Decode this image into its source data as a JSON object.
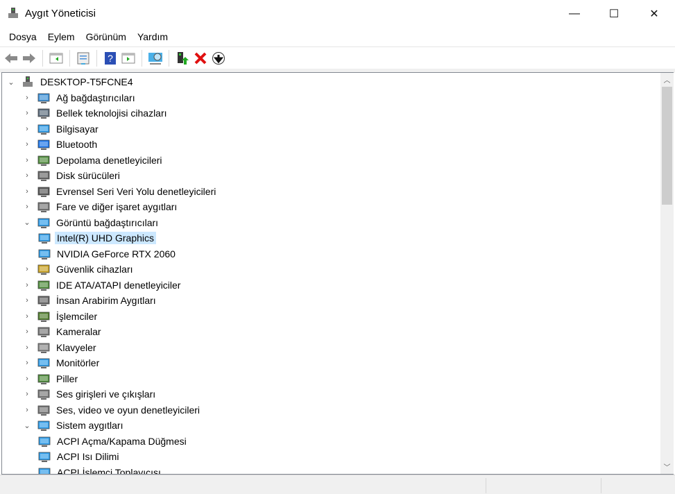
{
  "window": {
    "title": "Aygıt Yöneticisi",
    "minimize": "—",
    "maximize": "☐",
    "close": "✕"
  },
  "menu": [
    "Dosya",
    "Eylem",
    "Görünüm",
    "Yardım"
  ],
  "toolbar": [
    "back-icon",
    "forward-icon",
    "show-hide-console-tree-icon",
    "properties-icon",
    "help-icon",
    "show-action-pane-icon",
    "scan-hardware-icon",
    "update-driver-icon",
    "uninstall-icon",
    "disable-icon"
  ],
  "tree": {
    "root": "DESKTOP-T5FCNE4",
    "items": [
      {
        "label": "Ağ bağdaştırıcıları",
        "level": 1,
        "exp": "collapsed",
        "icon": "network-adapter-icon",
        "color": "#3a8fd6"
      },
      {
        "label": "Bellek teknolojisi cihazları",
        "level": 1,
        "exp": "collapsed",
        "icon": "memory-device-icon",
        "color": "#5a6a7a"
      },
      {
        "label": "Bilgisayar",
        "level": 1,
        "exp": "collapsed",
        "icon": "computer-icon",
        "color": "#2d9be8"
      },
      {
        "label": "Bluetooth",
        "level": 1,
        "exp": "collapsed",
        "icon": "bluetooth-icon",
        "color": "#1a73e8"
      },
      {
        "label": "Depolama denetleyicileri",
        "level": 1,
        "exp": "collapsed",
        "icon": "storage-controller-icon",
        "color": "#4d8a3a"
      },
      {
        "label": "Disk sürücüleri",
        "level": 1,
        "exp": "collapsed",
        "icon": "disk-drive-icon",
        "color": "#666"
      },
      {
        "label": "Evrensel Seri Veri Yolu denetleyicileri",
        "level": 1,
        "exp": "collapsed",
        "icon": "usb-icon",
        "color": "#555"
      },
      {
        "label": "Fare ve diğer işaret aygıtları",
        "level": 1,
        "exp": "collapsed",
        "icon": "mouse-icon",
        "color": "#777"
      },
      {
        "label": "Görüntü bağdaştırıcıları",
        "level": 1,
        "exp": "expanded",
        "icon": "display-adapter-icon",
        "color": "#2d9be8"
      },
      {
        "label": "Intel(R) UHD Graphics",
        "level": 2,
        "exp": "none",
        "icon": "display-adapter-icon",
        "color": "#2d9be8",
        "selected": true
      },
      {
        "label": "NVIDIA GeForce RTX 2060",
        "level": 2,
        "exp": "none",
        "icon": "display-adapter-icon",
        "color": "#2d9be8"
      },
      {
        "label": "Güvenlik cihazları",
        "level": 1,
        "exp": "collapsed",
        "icon": "security-device-icon",
        "color": "#c8a020"
      },
      {
        "label": "IDE ATA/ATAPI denetleyiciler",
        "level": 1,
        "exp": "collapsed",
        "icon": "ide-controller-icon",
        "color": "#4d8a3a"
      },
      {
        "label": "İnsan Arabirim Aygıtları",
        "level": 1,
        "exp": "collapsed",
        "icon": "hid-icon",
        "color": "#666"
      },
      {
        "label": "İşlemciler",
        "level": 1,
        "exp": "collapsed",
        "icon": "processor-icon",
        "color": "#4d7a2a"
      },
      {
        "label": "Kameralar",
        "level": 1,
        "exp": "collapsed",
        "icon": "camera-icon",
        "color": "#777"
      },
      {
        "label": "Klavyeler",
        "level": 1,
        "exp": "collapsed",
        "icon": "keyboard-icon",
        "color": "#888"
      },
      {
        "label": "Monitörler",
        "level": 1,
        "exp": "collapsed",
        "icon": "monitor-icon",
        "color": "#2d9be8"
      },
      {
        "label": "Piller",
        "level": 1,
        "exp": "collapsed",
        "icon": "battery-icon",
        "color": "#4d8a3a"
      },
      {
        "label": "Ses girişleri ve çıkışları",
        "level": 1,
        "exp": "collapsed",
        "icon": "speaker-icon",
        "color": "#777"
      },
      {
        "label": "Ses, video ve oyun denetleyicileri",
        "level": 1,
        "exp": "collapsed",
        "icon": "speaker-icon",
        "color": "#777"
      },
      {
        "label": "Sistem aygıtları",
        "level": 1,
        "exp": "expanded",
        "icon": "system-device-icon",
        "color": "#2d9be8"
      },
      {
        "label": "ACPI Açma/Kapama Düğmesi",
        "level": 2,
        "exp": "none",
        "icon": "system-device-icon",
        "color": "#2d9be8"
      },
      {
        "label": "ACPI Isı Dilimi",
        "level": 2,
        "exp": "none",
        "icon": "system-device-icon",
        "color": "#2d9be8"
      },
      {
        "label": "ACPI İşlemci Toplayıcısı",
        "level": 2,
        "exp": "none",
        "icon": "system-device-icon",
        "color": "#2d9be8"
      }
    ]
  }
}
